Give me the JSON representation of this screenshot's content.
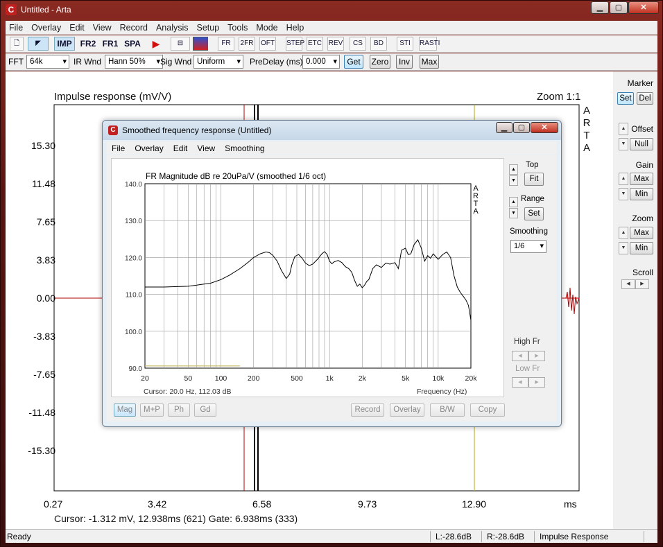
{
  "window": {
    "title": "Untitled - Arta"
  },
  "menu": [
    "File",
    "Overlay",
    "Edit",
    "View",
    "Record",
    "Analysis",
    "Setup",
    "Tools",
    "Mode",
    "Help"
  ],
  "toolbar": {
    "tools": [
      "IMP",
      "FR2",
      "FR1",
      "SPA"
    ],
    "analysis": [
      "FR",
      "2FR",
      "OFT",
      "STEP",
      "ETC",
      "REV",
      "CS",
      "BD",
      "STI",
      "RASTI"
    ]
  },
  "params": {
    "fft_label": "FFT",
    "fft_value": "64k",
    "irwnd_label": "IR Wnd",
    "irwnd_value": "Hann 50%",
    "sigwnd_label": "Sig Wnd",
    "sigwnd_value": "Uniform",
    "predelay_label": "PreDelay (ms)",
    "predelay_value": "0.000",
    "get": "Get",
    "zero": "Zero",
    "inv": "Inv",
    "max": "Max"
  },
  "main_plot": {
    "title": "Impulse response (mV/V)",
    "zoom": "Zoom 1:1",
    "arta": [
      "A",
      "R",
      "T",
      "A"
    ],
    "yticks": [
      "15.30",
      "11.48",
      "7.65",
      "3.83",
      "0.00",
      "-3.83",
      "-7.65",
      "-11.48",
      "-15.30"
    ],
    "xticks": [
      "0.27",
      "3.42",
      "6.58",
      "9.73",
      "12.90"
    ],
    "xunit": "ms",
    "cursor_text": "Cursor: -1.312 mV, 12.938ms (621)  Gate: 6.938ms (333)"
  },
  "right_panel": {
    "marker": "Marker",
    "set": "Set",
    "del": "Del",
    "offset": "Offset",
    "null": "Null",
    "gain": "Gain",
    "gain_max": "Max",
    "gain_min": "Min",
    "zoom": "Zoom",
    "zoom_max": "Max",
    "zoom_min": "Min",
    "scroll": "Scroll"
  },
  "status": {
    "ready": "Ready",
    "left": "L:-28.6dB",
    "right": "R:-28.6dB",
    "mode": "Impulse Response"
  },
  "child": {
    "title": "Smoothed frequency response (Untitled)",
    "menu": [
      "File",
      "Overlay",
      "Edit",
      "View",
      "Smoothing"
    ],
    "top": "Top",
    "fit": "Fit",
    "range": "Range",
    "set": "Set",
    "smoothing": "Smoothing",
    "smoothing_value": "1/6",
    "highfr": "High Fr",
    "lowfr": "Low Fr",
    "buttons_left": [
      "Mag",
      "M+P",
      "Ph",
      "Gd"
    ],
    "buttons_right": [
      "Record",
      "Overlay",
      "B/W",
      "Copy"
    ],
    "cursor_text": "Cursor: 20.0 Hz, 112.03 dB",
    "xunit": "Frequency (Hz)"
  },
  "chart_data": {
    "type": "line",
    "title": "FR Magnitude dB re 20uPa/V (smoothed 1/6 oct)",
    "xlabel": "Frequency (Hz)",
    "ylabel": "",
    "xscale": "log",
    "xlim": [
      20,
      20000
    ],
    "ylim": [
      90,
      140
    ],
    "yticks": [
      "140.0",
      "130.0",
      "120.0",
      "110.0",
      "100.0",
      "90.0"
    ],
    "xticks": [
      {
        "v": 20,
        "label": "20"
      },
      {
        "v": 50,
        "label": "50"
      },
      {
        "v": 100,
        "label": "100"
      },
      {
        "v": 200,
        "label": "200"
      },
      {
        "v": 500,
        "label": "500"
      },
      {
        "v": 1000,
        "label": "1k"
      },
      {
        "v": 2000,
        "label": "2k"
      },
      {
        "v": 5000,
        "label": "5k"
      },
      {
        "v": 10000,
        "label": "10k"
      },
      {
        "v": 20000,
        "label": "20k"
      }
    ],
    "grid": true,
    "series": [
      {
        "color": "#000000",
        "x": [
          20,
          30,
          40,
          50,
          60,
          70,
          80,
          100,
          120,
          150,
          180,
          200,
          230,
          260,
          280,
          300,
          330,
          360,
          400,
          430,
          450,
          480,
          520,
          560,
          600,
          650,
          700,
          780,
          850,
          900,
          950,
          1000,
          1050,
          1100,
          1200,
          1300,
          1400,
          1500,
          1600,
          1700,
          1800,
          1900,
          2000,
          2100,
          2200,
          2300,
          2500,
          2700,
          3000,
          3300,
          3600,
          4000,
          4300,
          4600,
          5000,
          5300,
          5600,
          6000,
          6500,
          7000,
          7500,
          8000,
          8500,
          9000,
          10000,
          11000,
          12000,
          13000,
          14000,
          15000,
          16000,
          17000,
          18000,
          19000,
          20000
        ],
        "y": [
          112.0,
          112.0,
          112.1,
          112.2,
          112.5,
          112.8,
          113.0,
          114.0,
          115.2,
          117.0,
          118.8,
          120.0,
          121.0,
          121.5,
          121.3,
          120.6,
          119.0,
          116.5,
          114.3,
          115.5,
          118.0,
          120.3,
          120.8,
          119.8,
          118.5,
          117.8,
          118.2,
          119.6,
          121.0,
          121.6,
          120.8,
          119.0,
          118.3,
          118.8,
          119.2,
          118.6,
          117.5,
          117.0,
          116.0,
          113.8,
          112.2,
          112.8,
          111.8,
          112.5,
          113.5,
          114.0,
          117.0,
          118.0,
          117.3,
          118.5,
          118.2,
          118.6,
          117.0,
          122.0,
          122.5,
          120.8,
          121.0,
          123.5,
          124.8,
          122.5,
          119.0,
          120.5,
          119.8,
          121.0,
          119.5,
          120.8,
          121.5,
          120.0,
          115.0,
          112.0,
          110.5,
          109.5,
          108.5,
          107.0,
          103.0
        ]
      },
      {
        "color": "#c8b860",
        "x": [
          20,
          150
        ],
        "y": [
          90.6,
          90.6
        ]
      }
    ]
  }
}
